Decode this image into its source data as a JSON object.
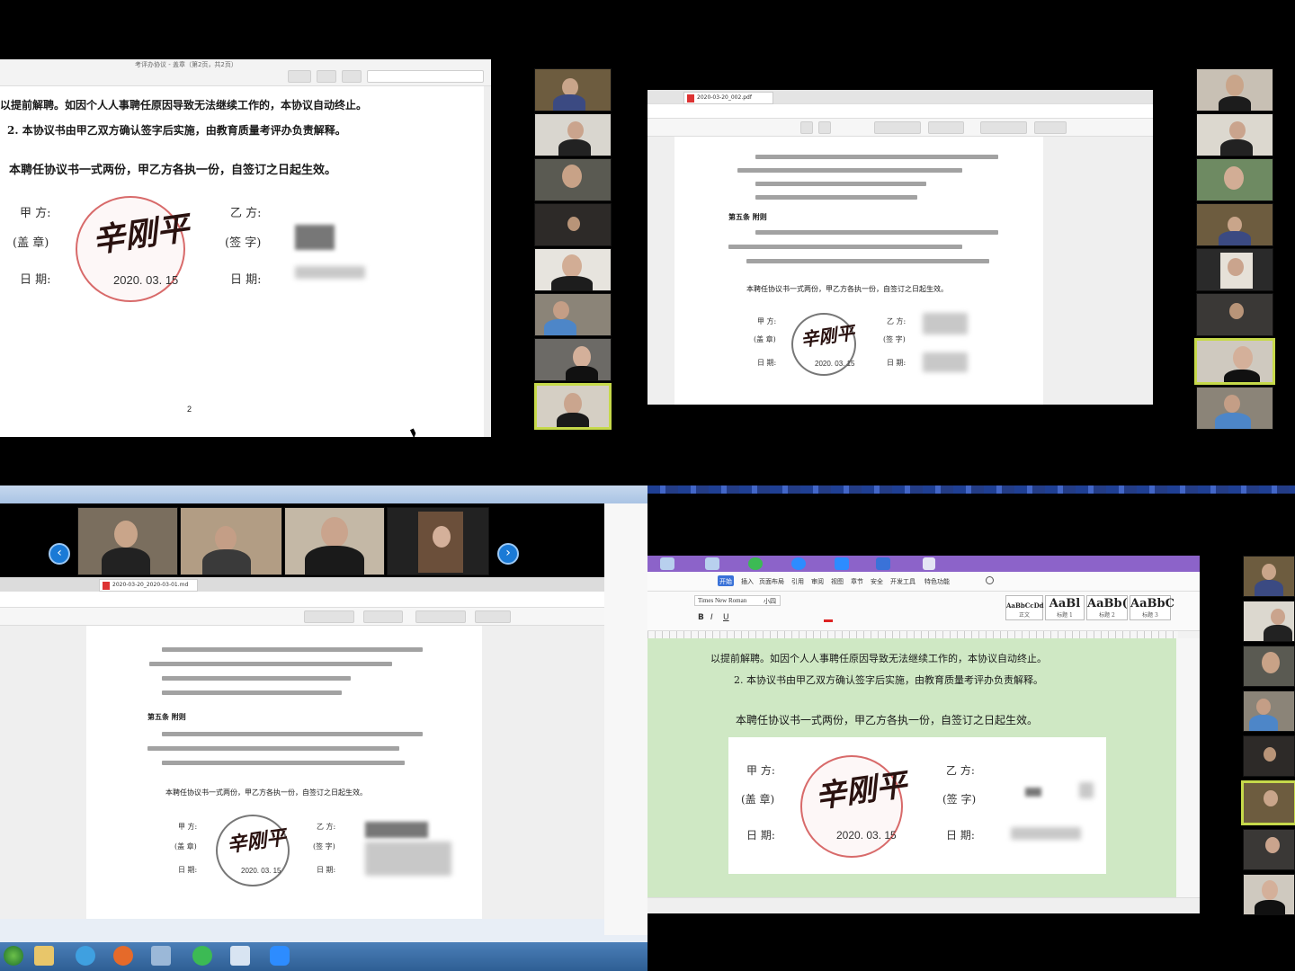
{
  "agreement": {
    "clause_tail": "以提前解聘。如因个人人事聘任原因导致无法继续工作的，本协议自动终止。",
    "clause_2": "2.  本协议书由甲乙双方确认签字后实施，由教育质量考评办负责解释。",
    "closing": "本聘任协议书一式两份，甲乙方各执一份，自签订之日起生效。",
    "party_a_label": "甲  方:",
    "party_a_seal_label": "(盖  章)",
    "party_b_label": "乙  方:",
    "party_b_sign_label": "(签  字)",
    "date_label": "日  期:",
    "signature": "辛刚平",
    "sign_date": "2020. 03. 15",
    "article5_heading": "第五条  附则"
  },
  "q1": {
    "window_title": "考评办协议 - 盖章（第2页，共2页）",
    "page_number": "2"
  },
  "q2": {
    "tab_title": "2020-03-20_002.pdf"
  },
  "q3": {
    "tab_title": "2020-03-20_2020-03-01.md"
  },
  "q4": {
    "font_name": "Times New Roman",
    "font_size": "小四",
    "styles": [
      {
        "sample": "AaBbCcDd",
        "label": "正文"
      },
      {
        "sample": "AaBl",
        "label": "标题 1"
      },
      {
        "sample": "AaBb(",
        "label": "标题 2"
      },
      {
        "sample": "AaBbC",
        "label": "标题 3"
      }
    ],
    "menu_tabs": [
      "开始",
      "插入",
      "页面布局",
      "引用",
      "审阅",
      "视图",
      "章节",
      "安全",
      "开发工具",
      "特色功能"
    ]
  },
  "colors": {
    "seal_red": "#d86a6a",
    "zoom_blue": "#1f3f93",
    "active_speaker": "#c6d94a",
    "wps_green_doc": "#cfe8c4",
    "wps_purple": "#8c63c9"
  }
}
